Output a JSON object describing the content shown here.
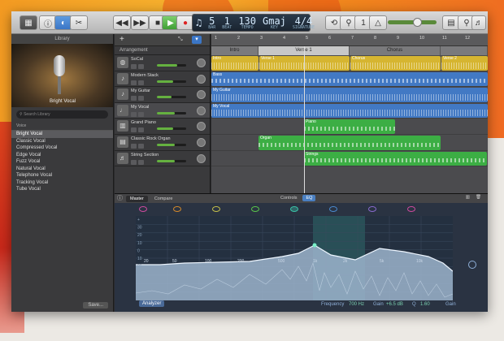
{
  "toolbar": {
    "lcd_bar": "5",
    "lcd_beat": "1",
    "lcd_bar_label": "BAR",
    "lcd_beat_label": "BEAT",
    "lcd_tempo": "130",
    "lcd_tempo_label": "TEMPO",
    "lcd_key": "Gmaj",
    "lcd_key_label": "KEY",
    "lcd_sig": "4/4",
    "lcd_sig_label": "SIGNATURE"
  },
  "library": {
    "title": "Library",
    "preset_name": "Bright Vocal",
    "search_placeholder": "Search Library",
    "category": "Voice",
    "items": [
      "Bright Vocal",
      "Classic Vocal",
      "Compressed Vocal",
      "Edge Vocal",
      "Fuzz Vocal",
      "Natural Vocal",
      "Telephone Vocal",
      "Tracking Vocal",
      "Tube Vocal"
    ],
    "save_label": "Save..."
  },
  "headers": {
    "arrangement_label": "Arrangement",
    "tracks": [
      {
        "name": "SoCal",
        "icon": "drum-icon",
        "level": 0.7
      },
      {
        "name": "Modern Stack",
        "icon": "guitar-icon",
        "level": 0.55
      },
      {
        "name": "My Guitar",
        "icon": "guitar-icon",
        "level": 0.5
      },
      {
        "name": "My Vocal",
        "icon": "mic-icon",
        "level": 0.6
      },
      {
        "name": "Grand Piano",
        "icon": "piano-icon",
        "level": 0.55
      },
      {
        "name": "Classic Rock Organ",
        "icon": "organ-icon",
        "level": 0.6
      },
      {
        "name": "String Section",
        "icon": "strings-icon",
        "level": 0.6
      }
    ]
  },
  "ruler": [
    "1",
    "2",
    "3",
    "4",
    "5",
    "6",
    "7",
    "8",
    "9",
    "10",
    "11",
    "12"
  ],
  "sections": [
    "Intro",
    "Verse 1",
    "Chorus"
  ],
  "regions": {
    "intro": "Intro",
    "verse1": "Verse 1",
    "chorus": "Chorus",
    "verse2": "Verse 2",
    "bass": "Bass",
    "guitar": "My Guitar",
    "vocal": "My Vocal",
    "piano": "Piano",
    "organ": "Organ",
    "strings": "Strings"
  },
  "editor": {
    "tab_master": "Master",
    "tab_compare": "Compare",
    "seg_controls": "Controls",
    "seg_eq": "EQ",
    "freq_labels": [
      "20",
      "50",
      "100",
      "200",
      "500",
      "1k",
      "2k",
      "5k",
      "10k"
    ],
    "db_labels": [
      "+",
      "30",
      "20",
      "10",
      "0",
      "10",
      "20",
      "30",
      "40",
      "50",
      "60"
    ],
    "analyzer": "Analyzer",
    "frequency_label": "Frequency",
    "frequency_value": "700 Hz",
    "gain_label": "Gain",
    "gain_value": "+6.5 dB",
    "q_label": "Q",
    "q_value": "1.60",
    "gain_col_label": "Gain"
  },
  "colors": {
    "drums": "#d6b530",
    "blue": "#4279c4",
    "green": "#3cae44",
    "eq_fill": "#9cb4cc",
    "accent": "#2f9f8a"
  }
}
